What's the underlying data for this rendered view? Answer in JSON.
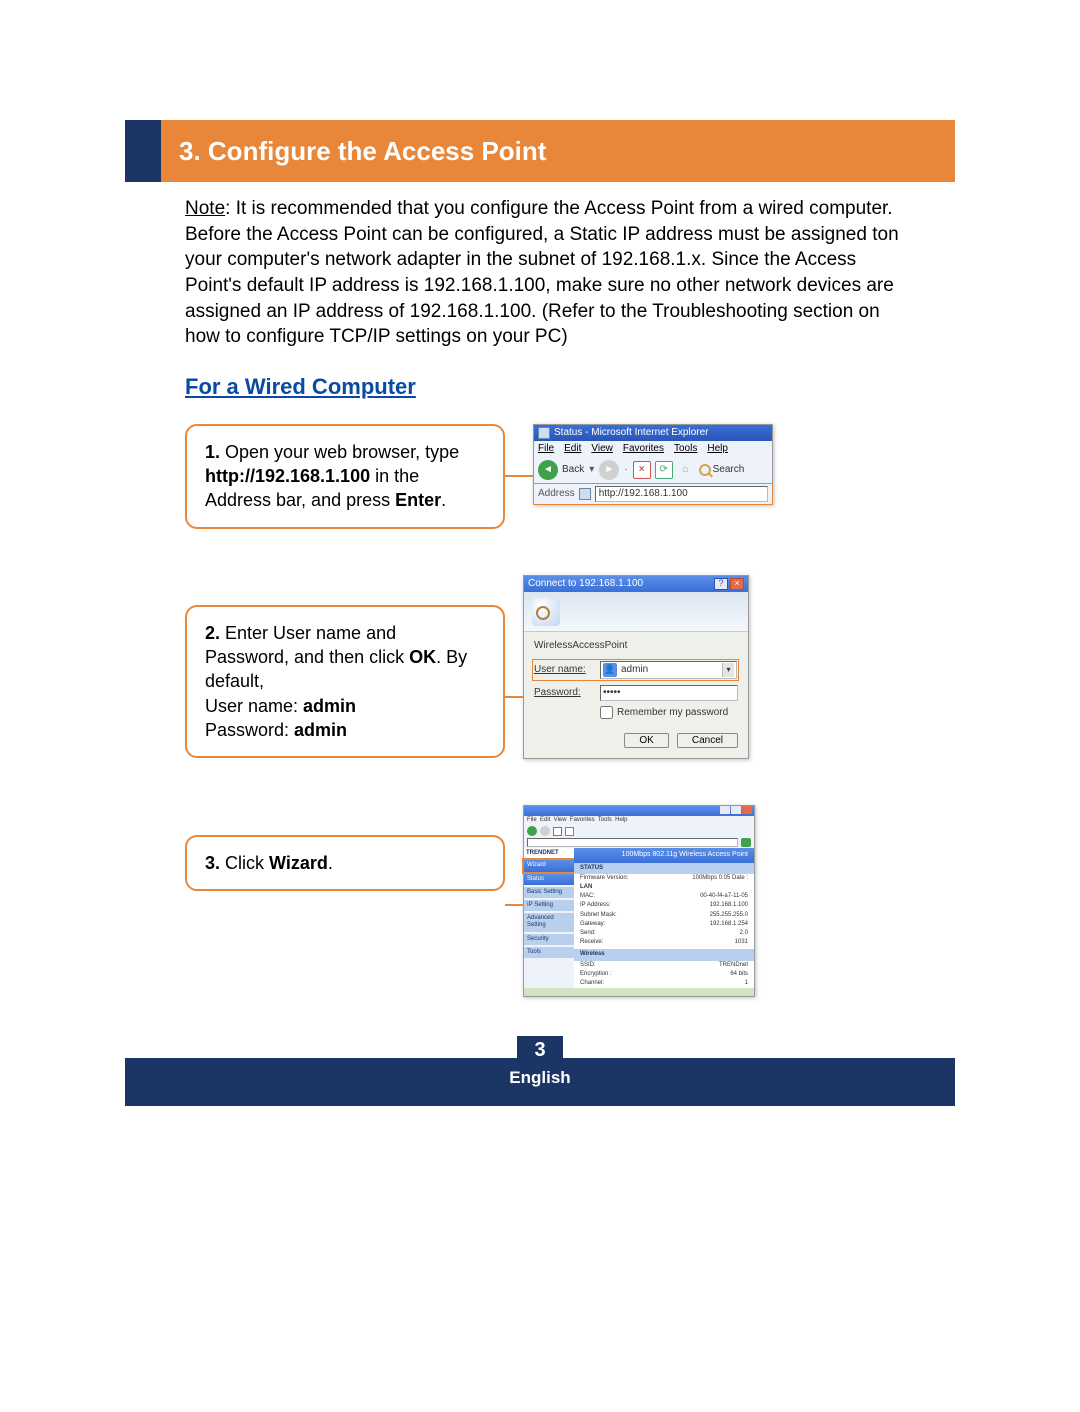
{
  "section_header": "3. Configure the Access Point",
  "note_label": "Note",
  "note_text": ": It is recommended that you configure the Access Point from a wired computer.  Before the Access Point can be configured, a Static IP address must be assigned ton your computer's network adapter in the subnet of 192.168.1.x.  Since the Access Point's default IP address is 192.168.1.100, make sure no other network devices are assigned an IP address of 192.168.1.100.  (Refer to the Troubleshooting section on how to configure TCP/IP settings on your PC)",
  "sub_heading": "For a Wired Computer",
  "step1": {
    "num": "1.",
    "a": " Open your web browser, type ",
    "b": "http://192.168.1.100",
    "c": " in the Address bar, and press ",
    "d": "Enter",
    "e": "."
  },
  "step2": {
    "num": "2.",
    "a": " Enter User name and Password, and then click ",
    "b": "OK",
    "c": ". By default,",
    "d": "User name: ",
    "e": "admin",
    "f": "Password: ",
    "g": "admin"
  },
  "step3": {
    "num": "3.",
    "a": " Click ",
    "b": "Wizard",
    "c": "."
  },
  "ie": {
    "title": "Status - Microsoft Internet Explorer",
    "menu": {
      "file": "File",
      "edit": "Edit",
      "view": "View",
      "favorites": "Favorites",
      "tools": "Tools",
      "help": "Help"
    },
    "back": "Back",
    "search": "Search",
    "address_label": "Address",
    "address_value": "http://192.168.1.100"
  },
  "dlg": {
    "title": "Connect to 192.168.1.100",
    "realm": "WirelessAccessPoint",
    "username_label": "User name:",
    "password_label": "Password:",
    "username_value": "admin",
    "password_value": "•••••",
    "remember": "Remember my password",
    "ok": "OK",
    "cancel": "Cancel"
  },
  "admin": {
    "brand": "TRENDNET",
    "banner": "100Mbps 802.11g Wireless Access Point",
    "side": {
      "wizard": "Wizard",
      "status": "Status",
      "basic": "Basic Setting",
      "ip": "IP Setting",
      "adv": "Advanced Setting",
      "security": "Security",
      "tools": "Tools"
    },
    "status": "STATUS",
    "fw_k": "Firmware Version:",
    "fw_v": "100Mbps 0.05        Date :",
    "lan": "LAN",
    "mac_k": "MAC:",
    "mac_v": "00-40-f4-a7-11-05",
    "ip_k": "IP Address:",
    "ip_v": "192.168.1.100",
    "mask_k": "Subnet Mask:",
    "mask_v": "255.255.255.0",
    "gw_k": "Gateway:",
    "gw_v": "192.168.1.254",
    "send_k": "Send:",
    "send_v": "2.0",
    "recv_k": "Receive:",
    "recv_v": "1031",
    "wireless": "Wireless",
    "ssid_k": "SSID:",
    "ssid_v": "TRENDnet",
    "enc_k": "Encryption :",
    "enc_v": "64 bits",
    "ch_k": "Channel:",
    "ch_v": "1"
  },
  "footer": {
    "page": "3",
    "lang": "English"
  }
}
